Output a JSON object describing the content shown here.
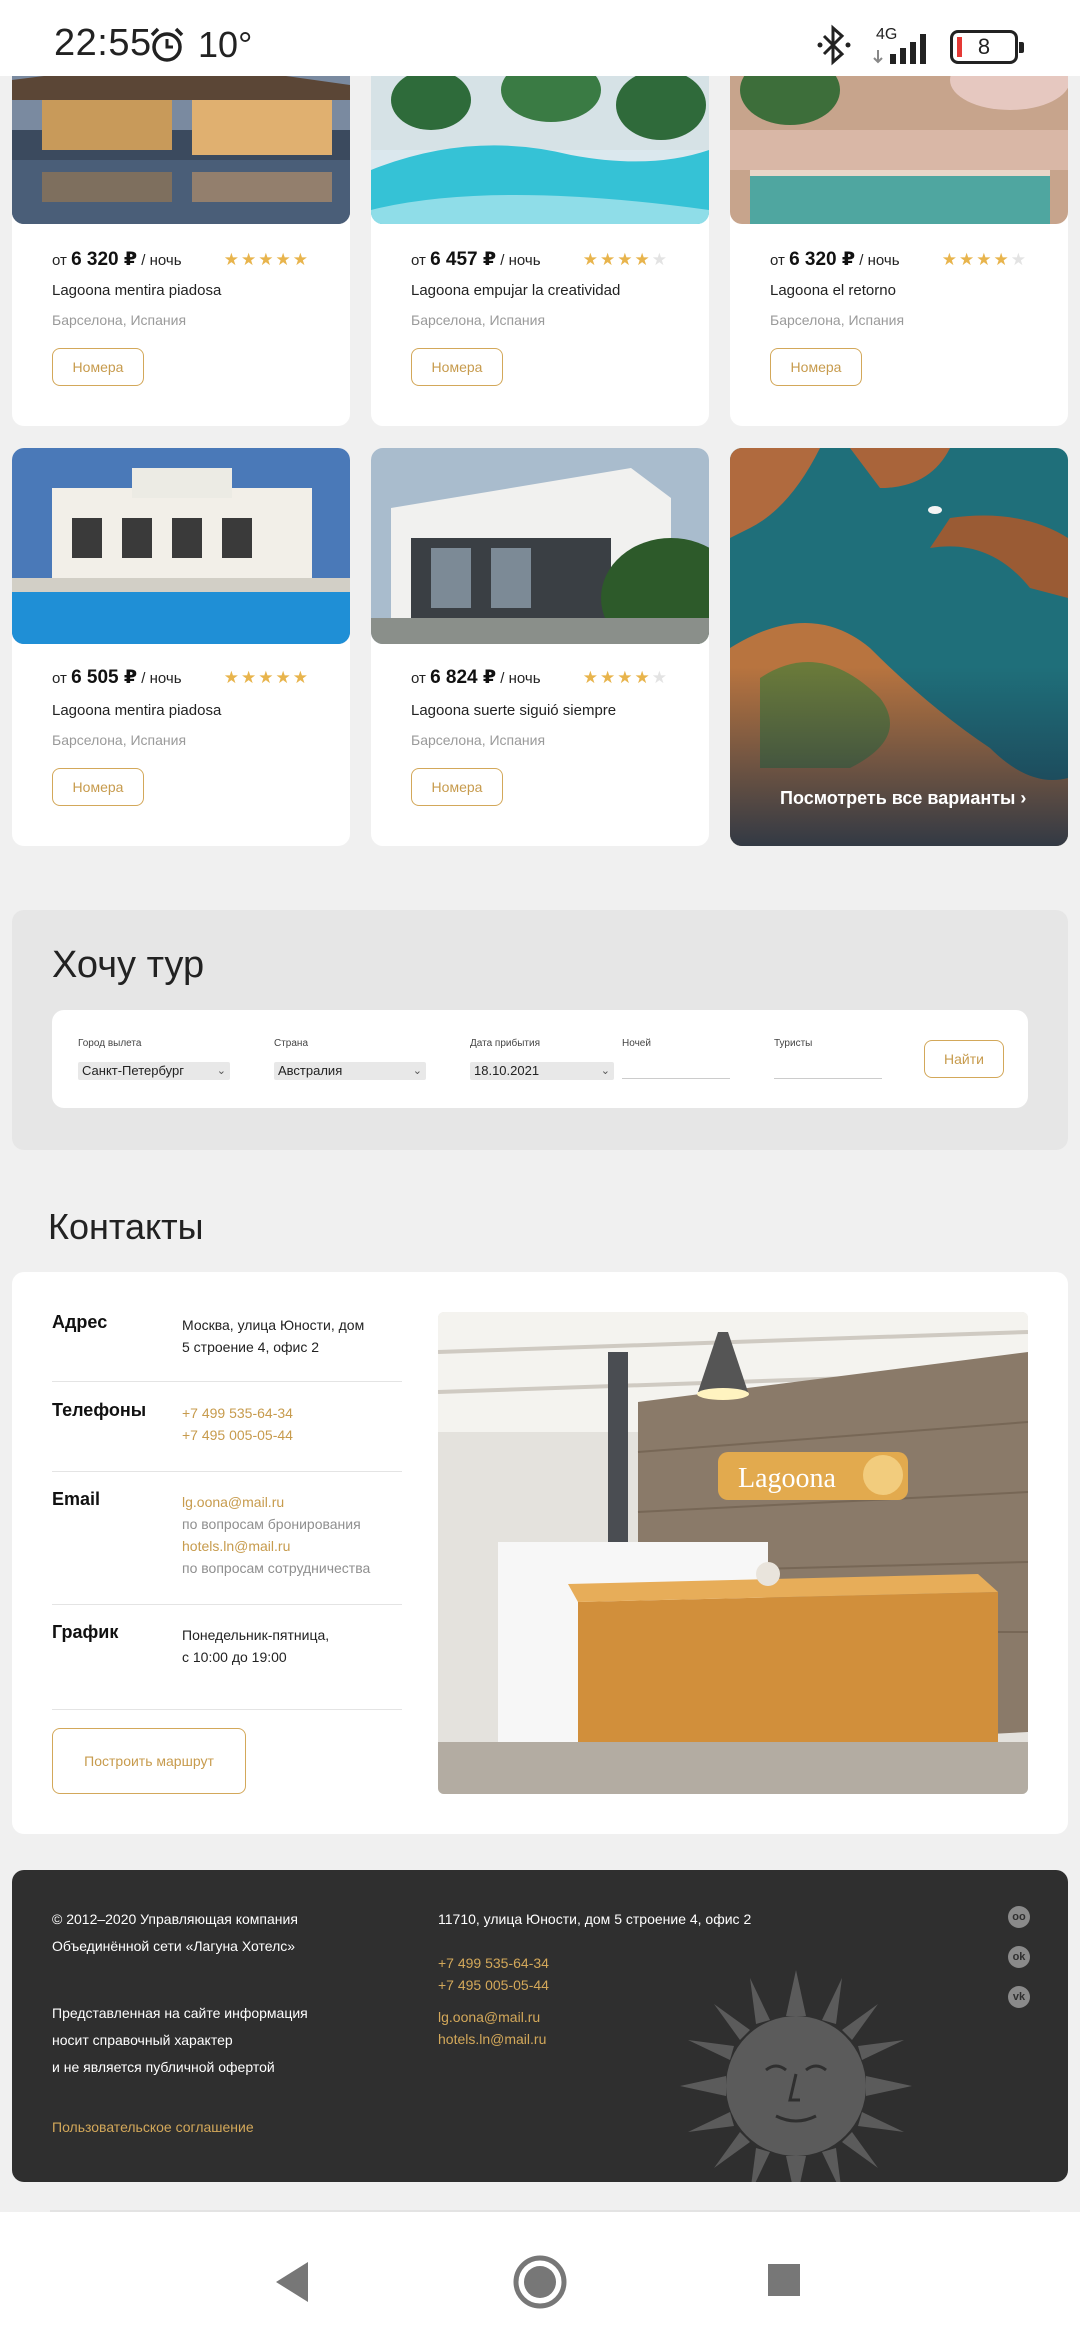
{
  "status_bar": {
    "time": "22:55",
    "temperature": "10°",
    "network": "4G",
    "battery": "8",
    "alarm_icon": "alarm-clock-icon",
    "bluetooth_icon": "bluetooth-icon"
  },
  "hotels": [
    {
      "price_prefix": "от",
      "price": "6 320 ₽",
      "price_suffix": "/ ночь",
      "rating": 5,
      "name": "Lagoona mentira piadosa",
      "location": "Барселона, Испания",
      "button": "Номера"
    },
    {
      "price_prefix": "от",
      "price": "6 457 ₽",
      "price_suffix": "/ ночь",
      "rating": 4,
      "name": "Lagoona empujar la creatividad",
      "location": "Барселона, Испания",
      "button": "Номера"
    },
    {
      "price_prefix": "от",
      "price": "6 320 ₽",
      "price_suffix": "/ ночь",
      "rating": 4,
      "name": "Lagoona el retorno",
      "location": "Барселона, Испания",
      "button": "Номера"
    },
    {
      "price_prefix": "от",
      "price": "6 505 ₽",
      "price_suffix": "/ ночь",
      "rating": 5,
      "name": "Lagoona mentira piadosa",
      "location": "Барселона, Испания",
      "button": "Номера"
    },
    {
      "price_prefix": "от",
      "price": "6 824 ₽",
      "price_suffix": "/ ночь",
      "rating": 4,
      "name": "Lagoona suerte siguió siempre",
      "location": "Барселона, Испания",
      "button": "Номера"
    }
  ],
  "promo": {
    "link": "Посмотреть все варианты",
    "chevron": "›"
  },
  "tour": {
    "title": "Хочу тур",
    "fields": {
      "city_label": "Город вылета",
      "city_value": "Санкт-Петербург",
      "country_label": "Страна",
      "country_value": "Австралия",
      "date_label": "Дата прибытия",
      "date_value": "18.10.2021",
      "nights_label": "Ночей",
      "nights_value": "",
      "tourists_label": "Туристы",
      "tourists_value": ""
    },
    "submit": "Найти"
  },
  "contacts": {
    "title": "Контакты",
    "address_label": "Адрес",
    "address_line1": "Москва, улица Юности, дом",
    "address_line2": "5 строение 4, офис 2",
    "phones_label": "Телефоны",
    "phone1": "+7 499 535-64-34",
    "phone2": "+7 495 005-05-44",
    "email_label": "Email",
    "email1": "lg.oona@mail.ru",
    "email1_note": "по вопросам бронирования",
    "email2": "hotels.ln@mail.ru",
    "email2_note": "по вопросам сотрудничества",
    "schedule_label": "График",
    "schedule_line1": "Понедельник-пятница,",
    "schedule_line2": "с 10:00 до 19:00",
    "route_button": "Построить маршрут",
    "sign_text": "Lagoona"
  },
  "footer": {
    "copyright_line1": "© 2012–2020 Управляющая компания",
    "copyright_line2": "Объединённой сети «Лагуна Хотелс»",
    "disclaimer_line1": "Представленная на сайте информация",
    "disclaimer_line2": "носит справочный характер",
    "disclaimer_line3": "и не является публичной офертой",
    "agreement_link": "Пользовательское соглашение",
    "address": "11710, улица Юности, дом 5 строение 4, офис 2",
    "phone1": "+7 499 535-64-34",
    "phone2": "+7 495 005-05-44",
    "email1": "lg.oona@mail.ru",
    "email2": "hotels.ln@mail.ru",
    "social": [
      "tripadvisor-icon",
      "odnoklassniki-icon",
      "vk-icon"
    ]
  },
  "colors": {
    "accent": "#c79b4d",
    "star": "#e8b44c",
    "footer_bg": "#2f2f2f",
    "page_bg": "#f0f0f0"
  },
  "nav": {
    "back_icon": "back-triangle-icon",
    "home_icon": "home-circle-icon",
    "recents_icon": "recents-square-icon"
  }
}
